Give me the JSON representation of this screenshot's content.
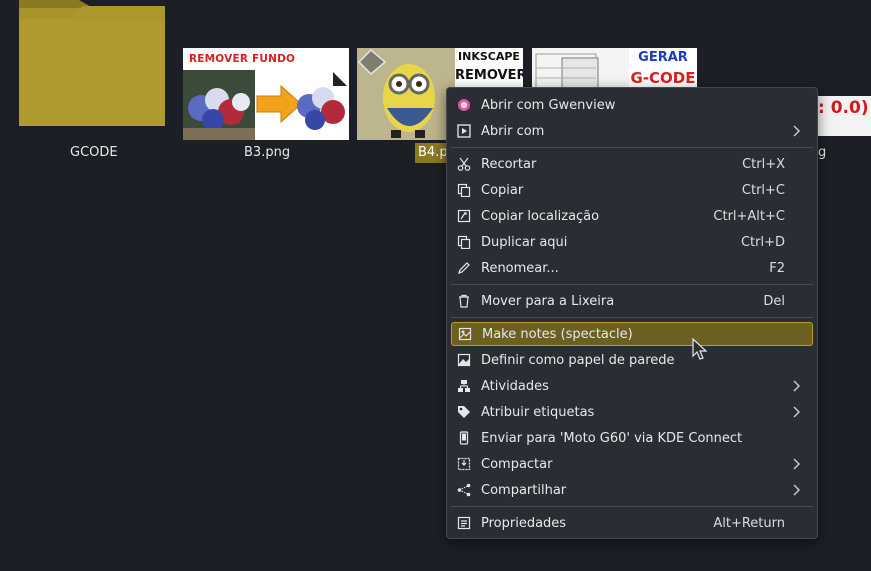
{
  "files": {
    "folder": {
      "label": "GCODE"
    },
    "b3": {
      "label": "B3.png",
      "banner_text": "REMOVER FUNDO INKSCAPE"
    },
    "b4": {
      "label": "B4.p",
      "banner_top": "INKSCAPE",
      "banner_bottom": "REMOVER"
    },
    "gcode": {
      "banner_top": "GERAR",
      "banner_bottom": "G-CODE"
    },
    "partial": {
      "label": "g",
      "thumb_text": ": 0.0)"
    }
  },
  "context_menu": {
    "items": [
      {
        "label": "Abrir com Gwenview",
        "icon": "gwenview-icon"
      },
      {
        "label": "Abrir com",
        "icon": "open-with-icon",
        "submenu": true
      },
      {
        "label": "Recortar",
        "shortcut": "Ctrl+X",
        "icon": "cut-icon"
      },
      {
        "label": "Copiar",
        "shortcut": "Ctrl+C",
        "icon": "copy-icon"
      },
      {
        "label": "Copiar localização",
        "shortcut": "Ctrl+Alt+C",
        "icon": "copy-location-icon"
      },
      {
        "label": "Duplicar aqui",
        "shortcut": "Ctrl+D",
        "icon": "duplicate-icon"
      },
      {
        "label": "Renomear...",
        "shortcut": "F2",
        "icon": "rename-icon"
      },
      {
        "label": "Mover para a Lixeira",
        "shortcut": "Del",
        "icon": "trash-icon"
      },
      {
        "label": "Make notes (spectacle)",
        "icon": "spectacle-icon",
        "highlighted": true
      },
      {
        "label": "Definir como papel de parede",
        "icon": "wallpaper-icon"
      },
      {
        "label": "Atividades",
        "icon": "activities-icon",
        "submenu": true
      },
      {
        "label": "Atribuir etiquetas",
        "icon": "tag-icon",
        "submenu": true
      },
      {
        "label": "Enviar para 'Moto G60' via KDE Connect",
        "icon": "phone-icon"
      },
      {
        "label": "Compactar",
        "icon": "compress-icon",
        "submenu": true
      },
      {
        "label": "Compartilhar",
        "icon": "share-icon",
        "submenu": true
      },
      {
        "label": "Propriedades",
        "shortcut": "Alt+Return",
        "icon": "properties-icon"
      }
    ]
  },
  "colors": {
    "background": "#1c1f25",
    "menu_background": "#2a2e34",
    "highlight": "#6b5f22",
    "highlight_border": "#b79e2e",
    "selection_label": "#8a7a1e",
    "folder": "#a8922a"
  }
}
